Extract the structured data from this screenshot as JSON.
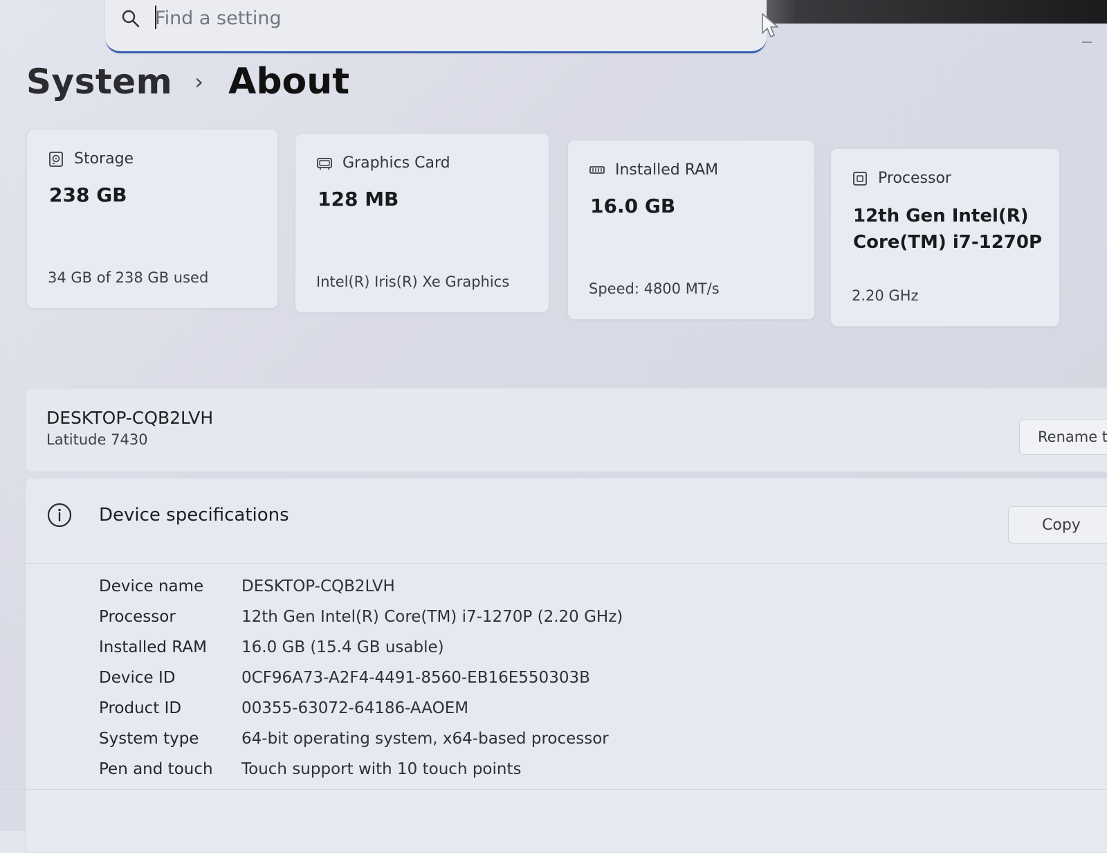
{
  "search": {
    "placeholder": "Find a setting"
  },
  "breadcrumb": {
    "parent": "System",
    "separator": "›",
    "current": "About"
  },
  "cards": [
    {
      "icon": "storage-icon",
      "label": "Storage",
      "value": "238 GB",
      "sub": "34 GB of 238 GB used"
    },
    {
      "icon": "graphics-card-icon",
      "label": "Graphics Card",
      "value": "128 MB",
      "sub": "Intel(R) Iris(R) Xe Graphics"
    },
    {
      "icon": "ram-icon",
      "label": "Installed RAM",
      "value": "16.0 GB",
      "sub": "Speed: 4800 MT/s"
    },
    {
      "icon": "processor-icon",
      "label": "Processor",
      "value": "12th Gen Intel(R) Core(TM) i7-1270P",
      "sub": "2.20 GHz"
    }
  ],
  "device": {
    "hostname": "DESKTOP-CQB2LVH",
    "model": "Latitude 7430",
    "rename_label": "Rename th"
  },
  "specs": {
    "title": "Device specifications",
    "copy_label": "Copy",
    "rows": [
      {
        "key": "Device name",
        "value": "DESKTOP-CQB2LVH"
      },
      {
        "key": "Processor",
        "value": "12th Gen Intel(R) Core(TM) i7-1270P (2.20 GHz)"
      },
      {
        "key": "Installed RAM",
        "value": "16.0 GB (15.4 GB usable)"
      },
      {
        "key": "Device ID",
        "value": "0CF96A73-A2F4-4491-8560-EB16E550303B"
      },
      {
        "key": "Product ID",
        "value": "00355-63072-64186-AAOEM"
      },
      {
        "key": "System type",
        "value": "64-bit operating system, x64-based processor"
      },
      {
        "key": "Pen and touch",
        "value": "Touch support with 10 touch points"
      }
    ]
  },
  "colors": {
    "search_underline": "#3a5fb0",
    "card_background": "#e8ebf1",
    "page_background": "#dadde6"
  }
}
